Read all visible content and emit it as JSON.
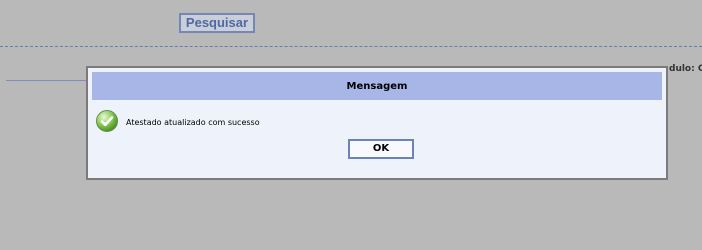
{
  "toolbar": {
    "search_label": "Pesquisar"
  },
  "background": {
    "modulo_label": "dulo: C"
  },
  "dialog": {
    "title": "Mensagem",
    "message": "Atestado atualizado com sucesso",
    "ok_label": "OK"
  },
  "icons": {
    "success": "success-check-icon"
  },
  "colors": {
    "page_bg": "#b9b9b9",
    "dialog_header": "#a7b6e6",
    "dialog_body": "#eef2fa",
    "button_border": "#6a84b8",
    "success_green": "#4f9a24"
  }
}
